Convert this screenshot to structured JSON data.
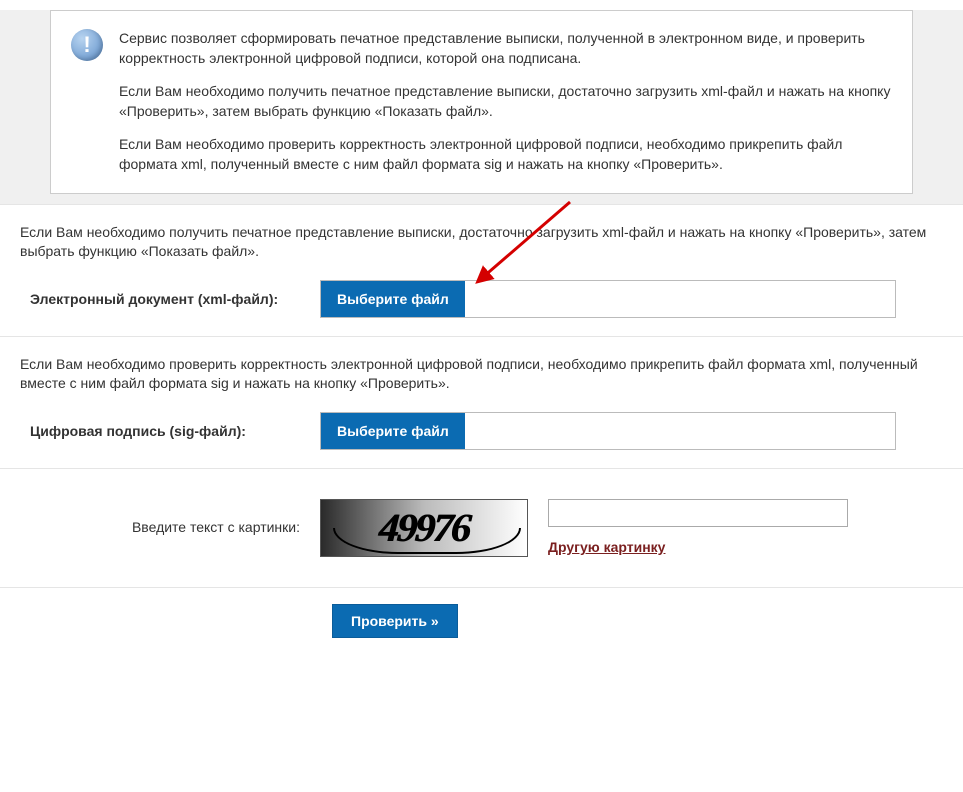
{
  "info": {
    "p1": "Сервис позволяет сформировать печатное представление выписки, полученной в электронном виде, и проверить корректность электронной цифровой подписи, которой она подписана.",
    "p2": "Если Вам необходимо получить печатное представление выписки, достаточно загрузить xml-файл и нажать на кнопку «Проверить», затем выбрать функцию «Показать файл».",
    "p3": "Если Вам необходимо проверить корректность электронной цифровой подписи, необходимо прикрепить файл формата xml, полученный вместе с ним файл формата sig и нажать на кнопку «Проверить»."
  },
  "xml_section": {
    "desc": "Если Вам необходимо получить печатное представление выписки, достаточно загрузить xml-файл и нажать на кнопку «Проверить», затем выбрать функцию «Показать файл».",
    "label": "Электронный документ (xml-файл):",
    "button": "Выберите файл",
    "value": ""
  },
  "sig_section": {
    "desc": "Если Вам необходимо проверить корректность электронной цифровой подписи, необходимо прикрепить файл формата xml, полученный вместе с ним файл формата sig и нажать на кнопку «Проверить».",
    "label": "Цифровая подпись (sig-файл):",
    "button": "Выберите файл",
    "value": ""
  },
  "captcha": {
    "label": "Введите текст с картинки:",
    "code": "49976",
    "refresh": "Другую картинку",
    "value": ""
  },
  "submit": {
    "label": "Проверить »"
  }
}
